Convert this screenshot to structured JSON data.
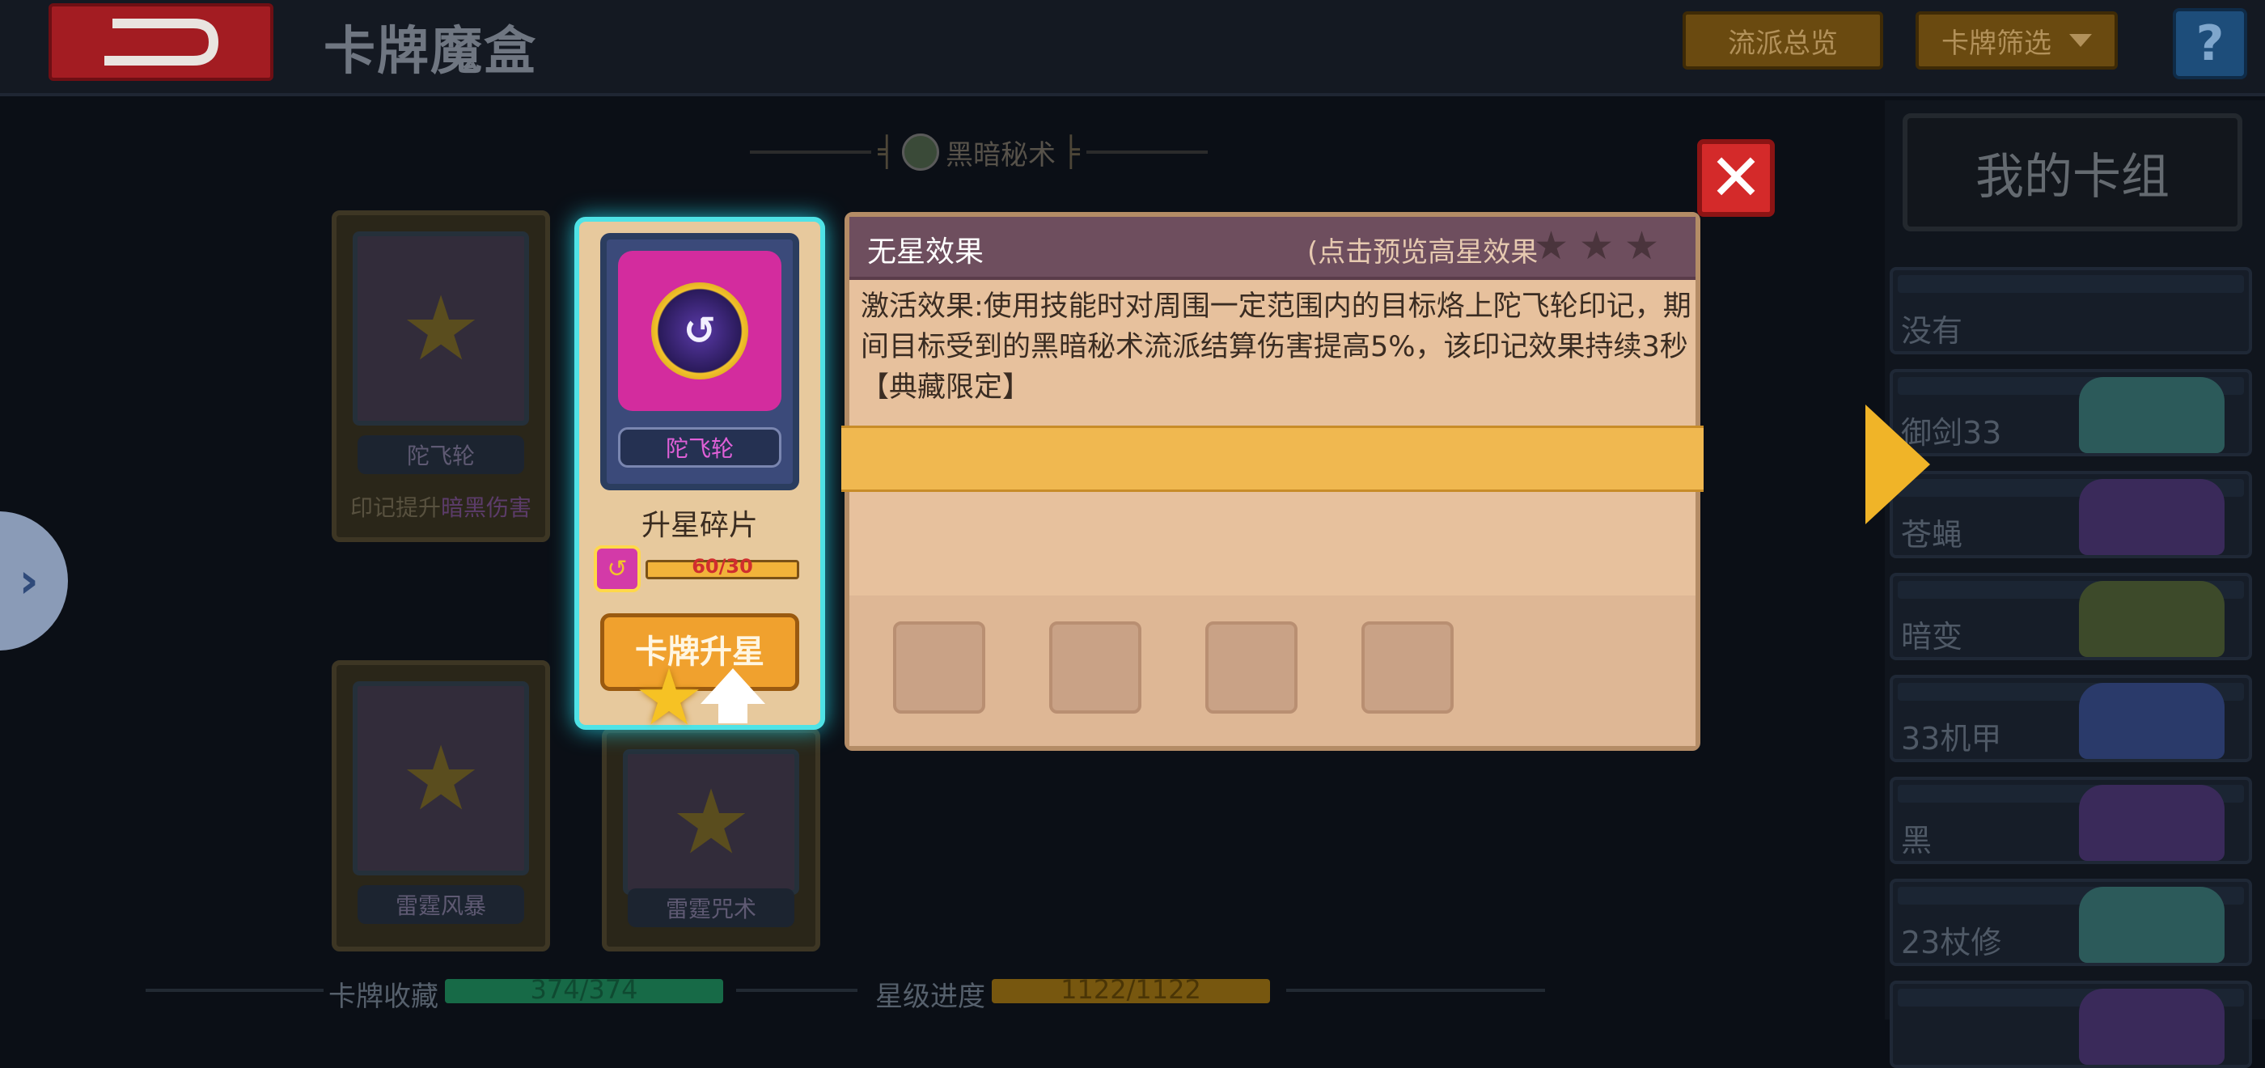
{
  "header": {
    "title": "卡牌魔盒",
    "school_overview_label": "流派总览",
    "card_filter_label": "卡牌筛选",
    "help_label": "?"
  },
  "section": {
    "title": "黑暗秘术"
  },
  "background_cards": [
    {
      "name": "陀飞轮",
      "desc_prefix": "印记提升",
      "desc_highlight": "暗黑伤害"
    },
    {
      "name": "雷霆风暴"
    },
    {
      "name": "雷霆咒术"
    }
  ],
  "selected_card": {
    "name": "陀飞轮",
    "shard_label": "升星碎片",
    "shard_progress_text": "60/30",
    "shard_progress_fraction": 1.0,
    "upgrade_button_label": "卡牌升星"
  },
  "effect_panel": {
    "title": "无星效果",
    "hint": "(点击预览高星效果",
    "stars_shown": 3,
    "description": "激活效果:使用技能时对周围一定范围内的目标烙上陀飞轮印记，期间目标受到的黑暗秘术流派结算伤害提高5%，该印记效果持续3秒【典藏限定】",
    "slot_count": 4
  },
  "close_button": {
    "label": "✕"
  },
  "deck_sidebar": {
    "title": "我的卡组",
    "items": [
      {
        "label": "没有"
      },
      {
        "label": "御剑33"
      },
      {
        "label": "苍蝇"
      },
      {
        "label": "暗变"
      },
      {
        "label": "33机甲"
      },
      {
        "label": "黑"
      },
      {
        "label": "23杖修"
      },
      {
        "label": ""
      }
    ]
  },
  "footer": {
    "collection_label": "卡牌收藏",
    "collection_text": "374/374",
    "collection_fraction": 1.0,
    "star_label": "星级进度",
    "star_text": "1122/1122",
    "star_fraction": 1.0
  },
  "colors": {
    "accent_gold": "#f0a12e",
    "panel_bg": "#e7c19d",
    "close_red": "#d42a2a",
    "selected_glow": "#4fe3e6"
  }
}
